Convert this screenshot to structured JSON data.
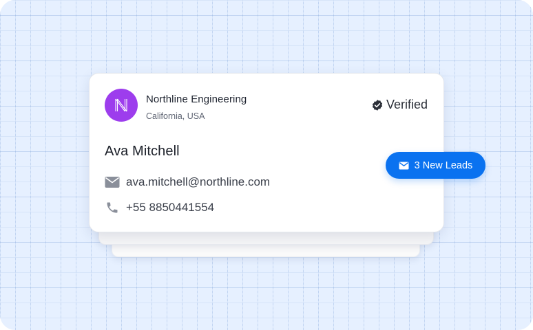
{
  "company": {
    "name": "Northline Engineering",
    "location": "California, USA",
    "logo_letter": "N",
    "logo_color": "#9d3ded",
    "logo_icon": "n-monogram-icon"
  },
  "status": {
    "label": "Verified",
    "icon": "verified-badge-icon"
  },
  "contact": {
    "name": "Ava Mitchell",
    "email": "ava.mitchell@northline.com",
    "phone": "+55 8850441554",
    "email_icon": "mail-icon",
    "phone_icon": "phone-icon"
  },
  "leads_badge": {
    "label": "3 New Leads",
    "icon": "envelope-icon",
    "color": "#0a72f0"
  }
}
